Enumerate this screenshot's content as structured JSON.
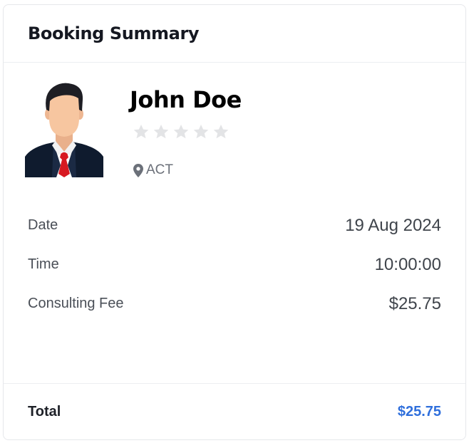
{
  "card": {
    "title": "Booking Summary"
  },
  "doctor": {
    "name": "John Doe",
    "rating": {
      "value": 0,
      "max": 5
    },
    "location": "ACT",
    "avatar_icon": "businessman-avatar-icon"
  },
  "details": {
    "date": {
      "label": "Date",
      "value": "19 Aug 2024"
    },
    "time": {
      "label": "Time",
      "value": "10:00:00"
    },
    "fee": {
      "label": "Consulting Fee",
      "value": "$25.75"
    }
  },
  "total": {
    "label": "Total",
    "value": "$25.75"
  },
  "colors": {
    "accent": "#2f6fdc",
    "star_empty": "#e3e4e6",
    "border": "#e6e8eb",
    "suit": "#0f1b2e",
    "tie": "#d71921",
    "skin": "#f7c6a0",
    "hair": "#1e1e24"
  },
  "icons": {
    "star": "star-icon",
    "location": "map-pin-icon"
  }
}
